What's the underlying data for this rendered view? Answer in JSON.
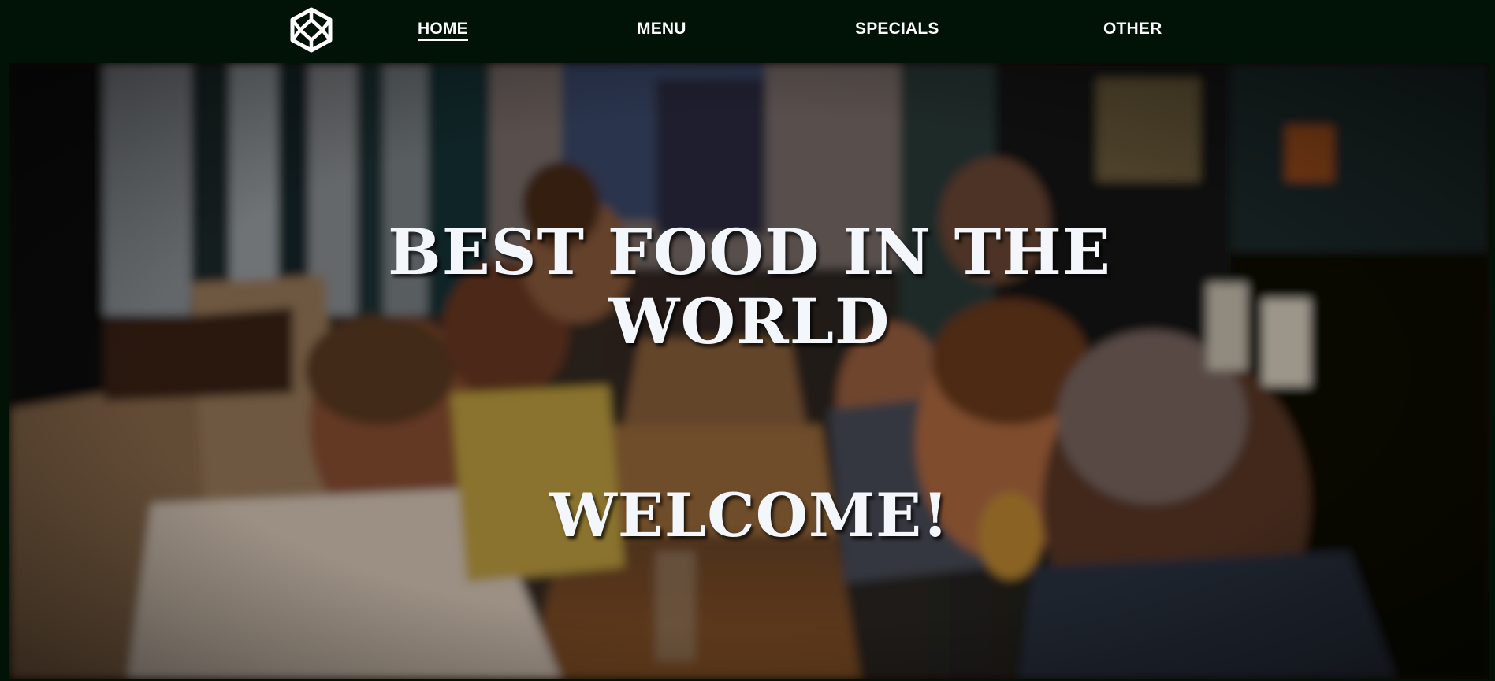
{
  "colors": {
    "nav_background": "#011206",
    "nav_text": "#ffffff",
    "hero_text": "#f3f6fa"
  },
  "nav": {
    "logo_icon": "cube-hexagon-icon",
    "items": [
      {
        "label": "HOME",
        "active": true
      },
      {
        "label": "MENU",
        "active": false
      },
      {
        "label": "SPECIALS",
        "active": false
      },
      {
        "label": "OTHER",
        "active": false
      }
    ]
  },
  "hero": {
    "background": "restaurant-diners-photo",
    "title_line1": "BEST FOOD IN THE",
    "title_line2": "WORLD",
    "welcome": "WELCOME!"
  }
}
